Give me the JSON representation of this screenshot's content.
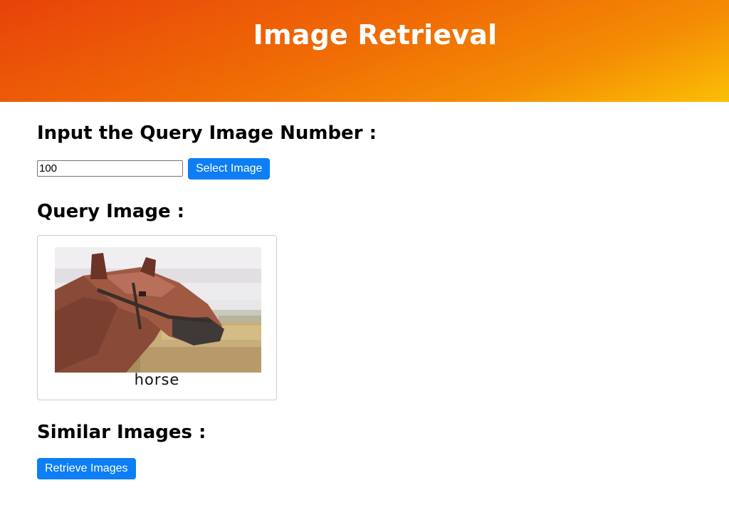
{
  "header": {
    "title": "Image Retrieval"
  },
  "query_input": {
    "heading": "Input the Query Image Number :",
    "value": "100",
    "button_label": "Select Image"
  },
  "query_image": {
    "heading": "Query Image :",
    "caption": "horse",
    "image_icon": "horse-photo"
  },
  "similar": {
    "heading": "Similar Images :",
    "button_label": "Retrieve Images"
  },
  "colors": {
    "header_gradient_start": "#e8420a",
    "header_gradient_end": "#fbbf05",
    "button_blue": "#0d7ef5"
  }
}
